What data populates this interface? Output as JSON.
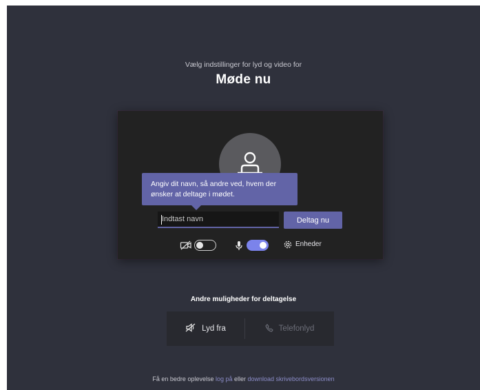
{
  "header": {
    "subtitle": "Vælg indstillinger for lyd og video for",
    "meeting_title": "Møde nu"
  },
  "preview": {
    "tooltip": "Angiv dit navn, så andre ved, hvem der ønsker at deltage i mødet.",
    "name_placeholder": "Indtast navn",
    "join_label": "Deltag nu",
    "video_enabled": false,
    "mic_enabled": true,
    "devices_label": "Enheder",
    "icons": [
      "person-icon",
      "camera-off-icon",
      "microphone-icon",
      "gear-icon"
    ]
  },
  "other_options": {
    "title": "Andre muligheder for deltagelse",
    "audio_off_label": "Lyd fra",
    "phone_audio_label": "Telefonlyd"
  },
  "footer": {
    "prefix": "Få en bedre oplevelse ",
    "login_link": "log på",
    "middle": " eller ",
    "download_link": "download skrivebordsversionen"
  },
  "colors": {
    "background": "#2f313c",
    "accent": "#6264a7",
    "toggle_on": "#7b83eb",
    "preview": "#222222"
  }
}
